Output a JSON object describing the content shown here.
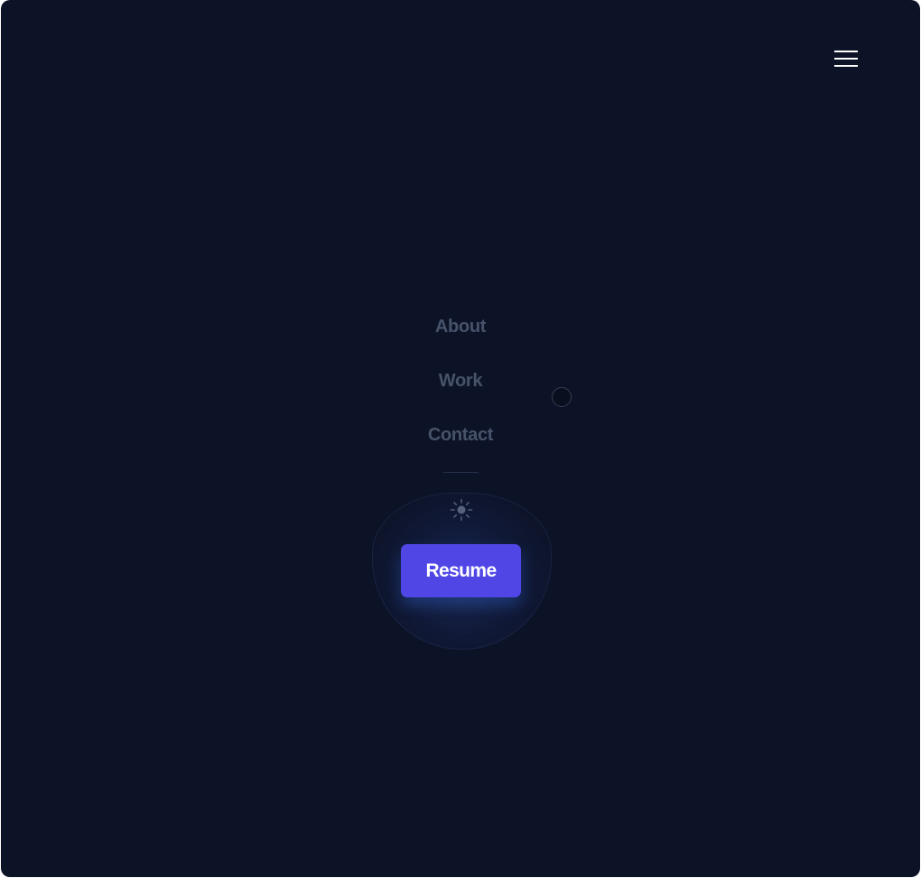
{
  "header": {
    "menu_icon": "hamburger-menu-icon"
  },
  "nav": {
    "links": [
      {
        "label": "About"
      },
      {
        "label": "Work"
      },
      {
        "label": "Contact"
      }
    ],
    "theme_icon": "sun-icon",
    "resume_label": "Resume"
  },
  "colors": {
    "background": "#0d1327",
    "link": "#47536a",
    "accent": "#4f46e5",
    "menu_icon": "#ffffff"
  }
}
